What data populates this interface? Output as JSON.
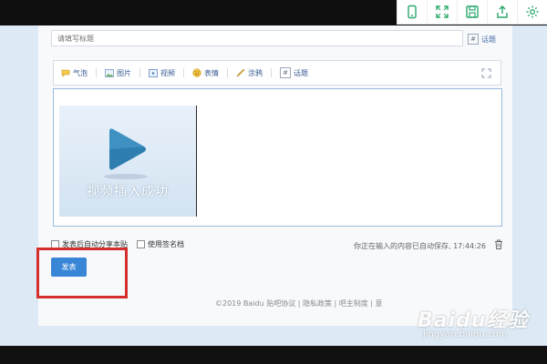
{
  "title_input": {
    "placeholder": "请填写标题"
  },
  "topic_link": {
    "hash": "#",
    "label": "话题"
  },
  "editor_toolbar": {
    "items": [
      {
        "label": "气泡",
        "icon": "bubble-icon"
      },
      {
        "label": "图片",
        "icon": "image-icon"
      },
      {
        "label": "视频",
        "icon": "video-icon"
      },
      {
        "label": "表情",
        "icon": "emoji-icon"
      },
      {
        "label": "涂鸦",
        "icon": "doodle-icon"
      },
      {
        "label": "话题",
        "icon": "topic-icon"
      }
    ]
  },
  "video": {
    "caption": "视频插入成功"
  },
  "options": {
    "share_label": "发表后自动分享本贴",
    "signature_label": "使用签名档"
  },
  "autosave": "你正在输入的内容已自动保存, 17:44:26",
  "submit_label": "发表",
  "footer": "©2019 Baidu  贴吧协议  |  隐私政策  |  吧主制度  |  意",
  "watermark": {
    "main": "Baidu经验",
    "sub": "jingyan.baidu.com"
  },
  "colors": {
    "accent": "#3a86d6",
    "highlight": "#d42e2e",
    "link": "#3b5c93"
  }
}
